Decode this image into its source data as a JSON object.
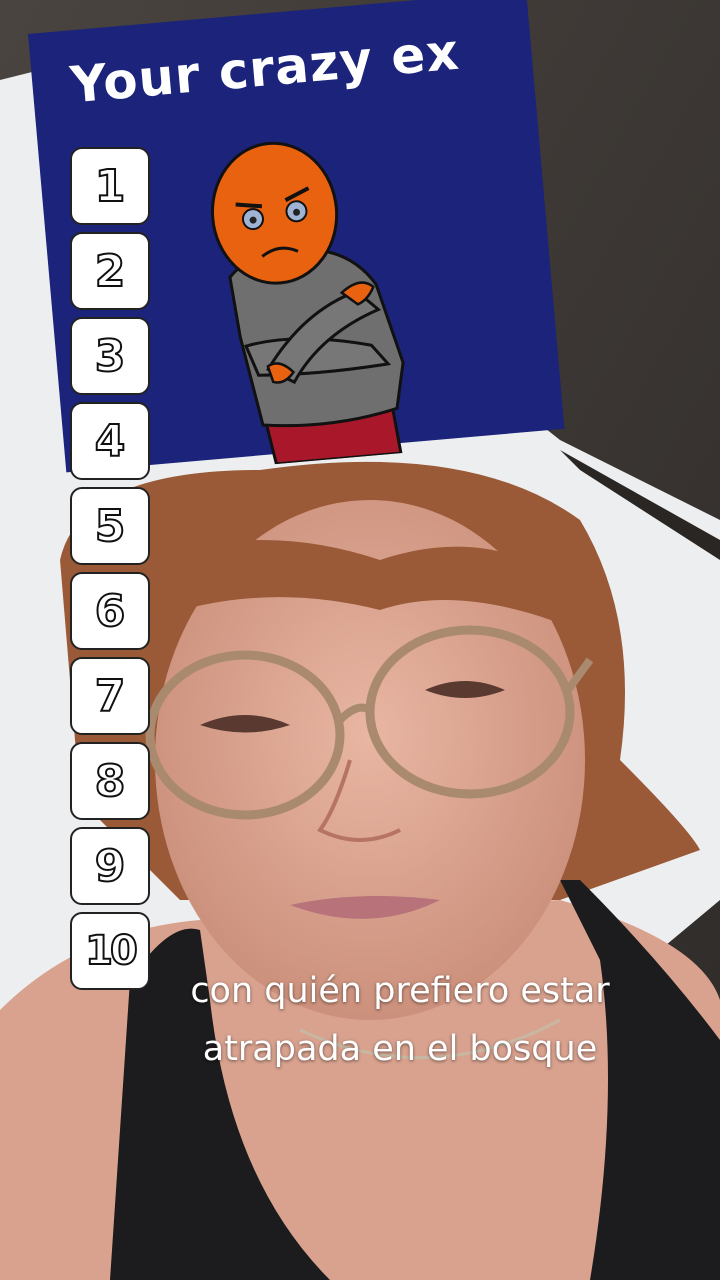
{
  "filter": {
    "title": "Your crazy ex",
    "character_icon": "grumpy-orange-head-arms-crossed",
    "background_color": "#1b237a"
  },
  "ranking": [
    {
      "label": "1"
    },
    {
      "label": "2"
    },
    {
      "label": "3"
    },
    {
      "label": "4"
    },
    {
      "label": "5"
    },
    {
      "label": "6"
    },
    {
      "label": "7"
    },
    {
      "label": "8"
    },
    {
      "label": "9"
    },
    {
      "label": "10"
    }
  ],
  "caption": {
    "line1": "con quién prefiero estar",
    "line2": "atrapada en el bosque"
  }
}
